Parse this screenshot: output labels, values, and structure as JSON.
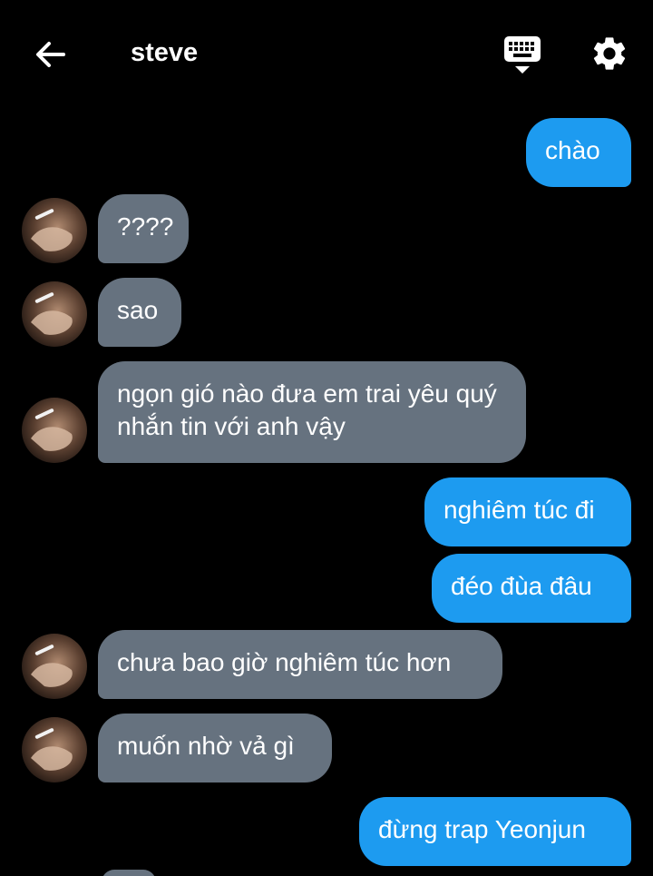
{
  "header": {
    "contact_name": "steve"
  },
  "icons": {
    "back": "back-arrow-icon",
    "keyboard": "keyboard-icon",
    "settings": "gear-icon"
  },
  "colors": {
    "background": "#000000",
    "outgoing_bubble": "#1d9bf0",
    "incoming_bubble": "#66727f",
    "text": "#ffffff"
  },
  "messages": [
    {
      "direction": "outgoing",
      "text": "chào"
    },
    {
      "direction": "incoming",
      "text": "????"
    },
    {
      "direction": "incoming",
      "text": "sao"
    },
    {
      "direction": "incoming",
      "text": "ngọn gió nào đưa em trai yêu quý nhắn tin với anh vậy"
    },
    {
      "direction": "outgoing",
      "text": "nghiêm túc đi"
    },
    {
      "direction": "outgoing",
      "text": "đéo đùa đâu"
    },
    {
      "direction": "incoming",
      "text": "chưa bao giờ nghiêm túc hơn"
    },
    {
      "direction": "incoming",
      "text": "muốn nhờ vả gì"
    },
    {
      "direction": "outgoing",
      "text": "đừng trap Yeonjun"
    }
  ]
}
